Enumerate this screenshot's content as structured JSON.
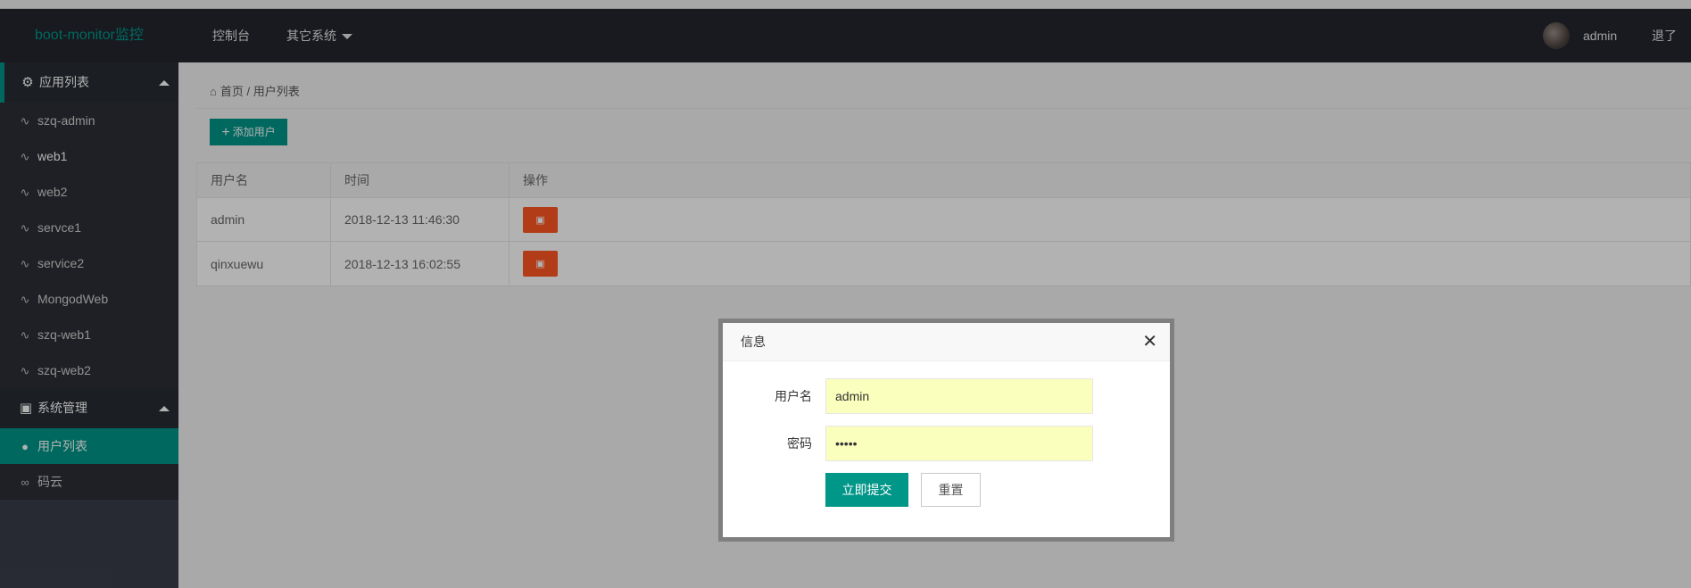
{
  "header": {
    "logo": "boot-monitor监控",
    "nav": [
      {
        "label": "控制台"
      },
      {
        "label": "其它系统"
      }
    ],
    "user": "admin",
    "logout": "退了"
  },
  "sidebar": {
    "groups": [
      {
        "label": "应用列表",
        "items": [
          {
            "label": "szq-admin"
          },
          {
            "label": "web1"
          },
          {
            "label": "web2"
          },
          {
            "label": "servce1"
          },
          {
            "label": "service2"
          },
          {
            "label": "MongodWeb"
          },
          {
            "label": "szq-web1"
          },
          {
            "label": "szq-web2"
          }
        ]
      },
      {
        "label": "系统管理",
        "items": [
          {
            "label": "用户列表"
          },
          {
            "label": "码云"
          }
        ]
      }
    ]
  },
  "main": {
    "breadcrumb": {
      "home": "首页",
      "separator": "/",
      "current": "用户列表"
    },
    "add_button": "添加用户",
    "table": {
      "headers": [
        "用户名",
        "时间",
        "操作"
      ],
      "rows": [
        {
          "username": "admin",
          "time": "2018-12-13 11:46:30"
        },
        {
          "username": "qinxuewu",
          "time": "2018-12-13 16:02:55"
        }
      ]
    }
  },
  "dialog": {
    "title": "信息",
    "username_label": "用户名",
    "username_value": "admin",
    "password_label": "密码",
    "password_value": "admin",
    "submit": "立即提交",
    "reset": "重置"
  },
  "colors": {
    "accent": "#009688",
    "danger": "#ff5722",
    "header_bg": "#23262e",
    "sidebar_bg": "#393d49"
  },
  "icons": {
    "home": "home-icon",
    "gear": "gear-icon",
    "monitor": "monitor-icon",
    "pulse": "pulse-icon",
    "users": "users-icon",
    "link": "link-icon",
    "trash": "trash-icon",
    "close": "close-icon"
  }
}
